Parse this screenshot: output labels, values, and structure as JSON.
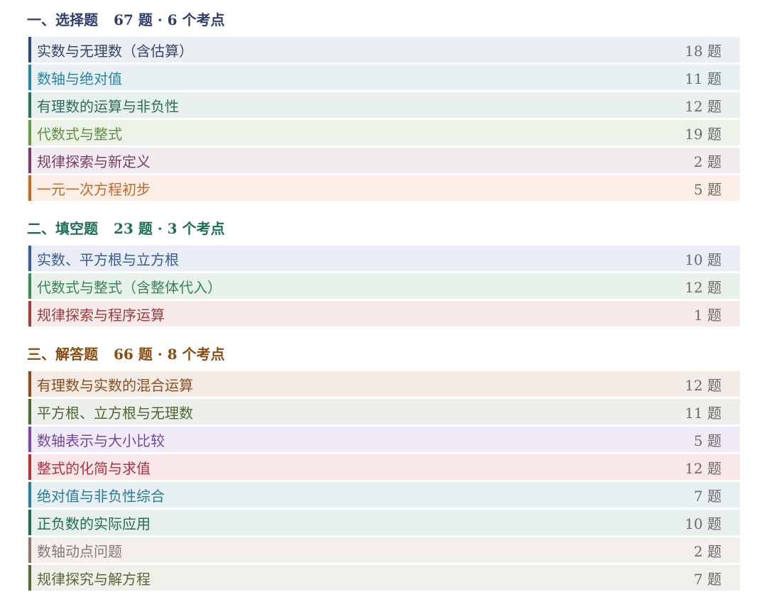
{
  "sections": [
    {
      "title": "一、选择题",
      "summary": "67 题 · 6 个考点",
      "color": "#2f3f6b",
      "items": [
        {
          "label": "实数与无理数（含估算）",
          "count": "18 题",
          "accent": "#2f4a7a",
          "text_color": "#34466b",
          "bg": "#eceff2"
        },
        {
          "label": "数轴与绝对值",
          "count": "11 题",
          "accent": "#2c86a3",
          "text_color": "#2a84a3",
          "bg": "#e7f1f4"
        },
        {
          "label": "有理数的运算与非负性",
          "count": "12 题",
          "accent": "#2a7360",
          "text_color": "#2b6e5d",
          "bg": "#e8f0ee"
        },
        {
          "label": "代数式与整式",
          "count": "19 题",
          "accent": "#6a9a48",
          "text_color": "#5f8e45",
          "bg": "#eef3e9"
        },
        {
          "label": "规律探索与新定义",
          "count": "2 题",
          "accent": "#7e3c6a",
          "text_color": "#7b3d67",
          "bg": "#f2ebf0"
        },
        {
          "label": "一元一次方程初步",
          "count": "5 题",
          "accent": "#c06b29",
          "text_color": "#c0692b",
          "bg": "#fbeee6"
        }
      ]
    },
    {
      "title": "二、填空题",
      "summary": "23 题 · 3 个考点",
      "color": "#1e6e55",
      "items": [
        {
          "label": "实数、平方根与立方根",
          "count": "10 题",
          "accent": "#3b5c9c",
          "text_color": "#3c5a90",
          "bg": "#e9edf6"
        },
        {
          "label": "代数式与整式（含整体代入）",
          "count": "12 题",
          "accent": "#3f8a58",
          "text_color": "#3a8354",
          "bg": "#e8f2eb"
        },
        {
          "label": "规律探索与程序运算",
          "count": "1 题",
          "accent": "#a23e3e",
          "text_color": "#9c3b3b",
          "bg": "#f6eaea"
        }
      ]
    },
    {
      "title": "三、解答题",
      "summary": "66 题 · 8 个考点",
      "color": "#8a4a10",
      "items": [
        {
          "label": "有理数与实数的混合运算",
          "count": "12 题",
          "accent": "#8a4e1d",
          "text_color": "#8a4e1f",
          "bg": "#f3ece6"
        },
        {
          "label": "平方根、立方根与无理数",
          "count": "11 题",
          "accent": "#4f6a35",
          "text_color": "#4d6736",
          "bg": "#edf0ea"
        },
        {
          "label": "数轴表示与大小比较",
          "count": "5 题",
          "accent": "#7a4aa6",
          "text_color": "#7647a1",
          "bg": "#f0ebf6"
        },
        {
          "label": "整式的化简与求值",
          "count": "12 题",
          "accent": "#b0343f",
          "text_color": "#ad3340",
          "bg": "#f8e8e9"
        },
        {
          "label": "绝对值与非负性综合",
          "count": "7 题",
          "accent": "#2e7d99",
          "text_color": "#2d7a96",
          "bg": "#e7f0f3"
        },
        {
          "label": "正负数的实际应用",
          "count": "10 题",
          "accent": "#1f6b5a",
          "text_color": "#226b5b",
          "bg": "#e7efed"
        },
        {
          "label": "数轴动点问题",
          "count": "2 题",
          "accent": "#8e7a72",
          "text_color": "#8a7a73",
          "bg": "#f2efed"
        },
        {
          "label": "规律探究与解方程",
          "count": "7 题",
          "accent": "#566a36",
          "text_color": "#56683a",
          "bg": "#eef0e9"
        }
      ]
    }
  ]
}
